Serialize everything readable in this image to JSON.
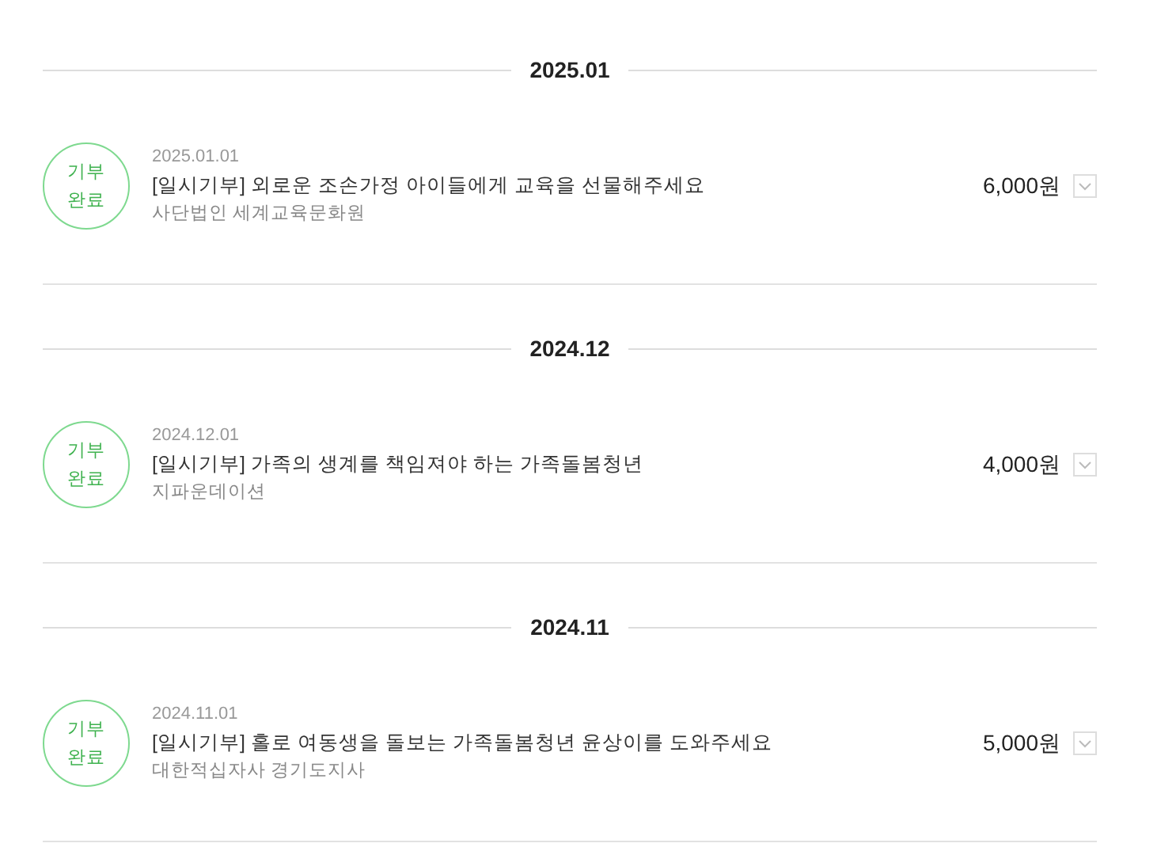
{
  "sections": [
    {
      "month": "2025.01",
      "donations": [
        {
          "status": "기부 완료",
          "date": "2025.01.01",
          "title": "[일시기부] 외로운 조손가정 아이들에게 교육을 선물해주세요",
          "organization": "사단법인 세계교육문화원",
          "amount": "6,000원",
          "expanded": false
        }
      ]
    },
    {
      "month": "2024.12",
      "donations": [
        {
          "status": "기부 완료",
          "date": "2024.12.01",
          "title": "[일시기부] 가족의 생계를 책임져야 하는 가족돌봄청년",
          "organization": "지파운데이션",
          "amount": "4,000원",
          "expanded": false
        }
      ]
    },
    {
      "month": "2024.11",
      "donations": [
        {
          "status": "기부 완료",
          "date": "2024.11.01",
          "title": "[일시기부] 홀로 여동생을 돌보는 가족돌봄청년 윤상이를 도와주세요",
          "organization": "대한적십자사 경기도지사",
          "amount": "5,000원",
          "expanded": false
        }
      ]
    }
  ]
}
